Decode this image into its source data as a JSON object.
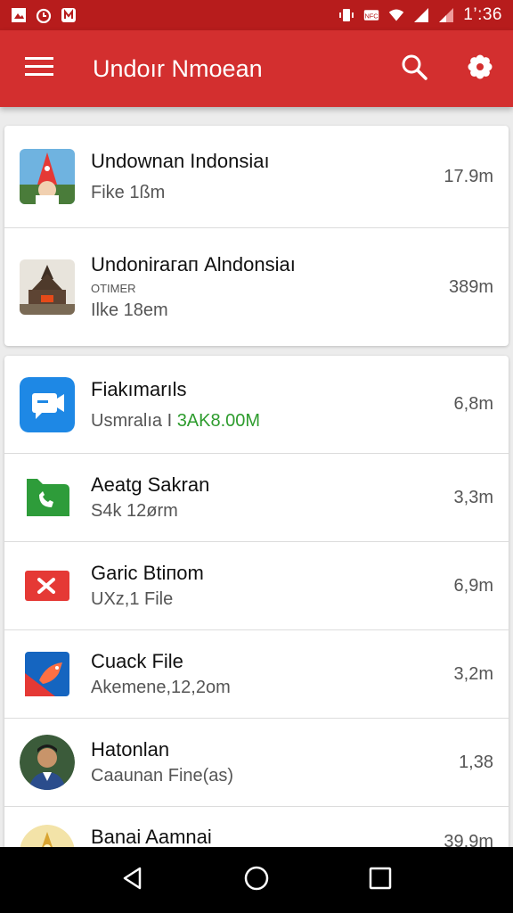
{
  "status_bar": {
    "time": "1’:36",
    "left_icons": [
      "image-notification-icon",
      "alarm-icon",
      "app-notification-icon"
    ],
    "right_icons": [
      "vibrate-icon",
      "nfc-icon",
      "wifi-icon",
      "signal-icon",
      "signal-weak-icon"
    ]
  },
  "app_bar": {
    "title": "Undoır Nmoean",
    "color": "#d32f2f"
  },
  "pinned_items": [
    {
      "name": "Undownan Indonsiaı",
      "tag": "",
      "sub": "Fike 1ßm",
      "size": "17.9m",
      "icon": "landmark-photo-icon"
    },
    {
      "name": "Undonirагап Alndonsiaı",
      "tag": "OTIMER",
      "sub": "Ilke 18em",
      "size": "389m",
      "icon": "temple-photo-icon"
    }
  ],
  "items": [
    {
      "name": "Fiakımarıls",
      "sub_prefix": "Usmralıa I ",
      "sub_highlight": "3AK8.00M",
      "size": "6,8m",
      "icon": "chat-app-icon"
    },
    {
      "name": "Aeatg Sakrаn",
      "sub": "S4k 12ørm",
      "size": "3,3m",
      "icon": "phone-app-icon"
    },
    {
      "name": "Garic Btiпom",
      "sub": "UXz,1 File",
      "size": "6,9m",
      "icon": "mail-app-icon"
    },
    {
      "name": "Cuack File",
      "sub": "Akemene,12,2om",
      "size": "3,2m",
      "icon": "bird-app-icon"
    },
    {
      "name": "Hatonlan",
      "sub": "Caaunan Fine(as)",
      "size": "1,38",
      "size_color": "#d32f2f",
      "icon": "person-photo-icon"
    },
    {
      "name": "Banai Aamnai",
      "sub": "",
      "size": "39,9m",
      "icon": "golden-photo-icon"
    }
  ],
  "nav": {
    "icons": [
      "back-icon",
      "home-icon",
      "recents-icon"
    ]
  }
}
